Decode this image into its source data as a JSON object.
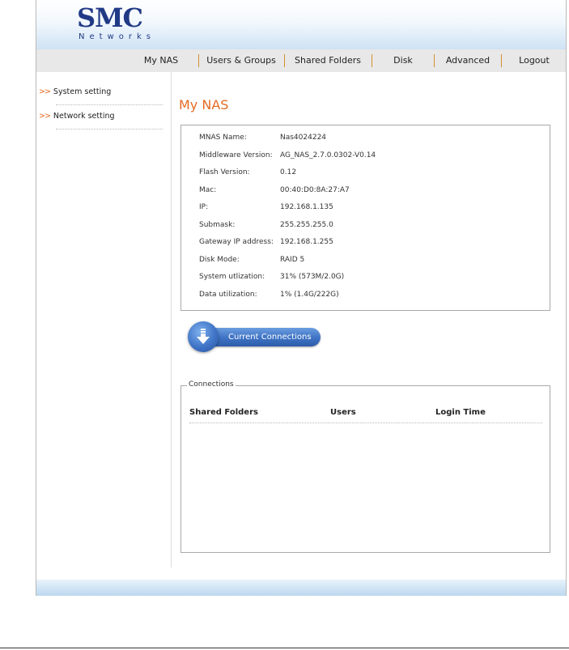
{
  "brand": {
    "logo_main": "SMC",
    "logo_sub": "Networks"
  },
  "nav": {
    "items": [
      {
        "label": "My NAS"
      },
      {
        "label": "Users & Groups"
      },
      {
        "label": "Shared Folders"
      },
      {
        "label": "Disk"
      },
      {
        "label": "Advanced"
      },
      {
        "label": "Logout"
      }
    ]
  },
  "sidebar": {
    "arrow": ">>",
    "items": [
      {
        "label": "System setting"
      },
      {
        "label": "Network setting"
      }
    ]
  },
  "page": {
    "title": "My NAS"
  },
  "info": {
    "rows": [
      {
        "label": "MNAS Name:",
        "value": "Nas4024224"
      },
      {
        "label": "Middleware Version:",
        "value": "AG_NAS_2.7.0.0302-V0.14"
      },
      {
        "label": "Flash Version:",
        "value": "0.12"
      },
      {
        "label": "Mac:",
        "value": "00:40:D0:8A:27:A7"
      },
      {
        "label": "IP:",
        "value": "192.168.1.135"
      },
      {
        "label": "Submask:",
        "value": "255.255.255.0"
      },
      {
        "label": "Gateway IP address:",
        "value": "192.168.1.255"
      },
      {
        "label": "Disk Mode:",
        "value": "RAID 5"
      },
      {
        "label": "System utlization:",
        "value": "31% (573M/2.0G)"
      },
      {
        "label": "Data utilization:",
        "value": "1% (1.4G/222G)"
      }
    ]
  },
  "connections": {
    "button_label": "Current Connections",
    "button_icon": "download-arrow-icon",
    "legend": "Connections",
    "columns": [
      "Shared Folders",
      "Users",
      "Login Time"
    ]
  },
  "colors": {
    "accent_orange": "#e46b24",
    "brand_navy": "#213a86",
    "button_blue": "#3e72c4"
  }
}
